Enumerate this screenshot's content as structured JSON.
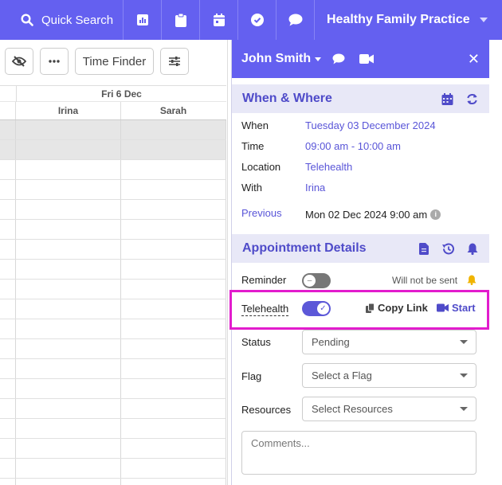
{
  "topnav": {
    "quick_search_label": "Quick Search",
    "practice_name": "Healthy Family Practice",
    "buttons": [
      "chart-icon",
      "clipboard-icon",
      "calendar-icon",
      "check-circle-icon",
      "chat-icon"
    ]
  },
  "toolbar": {
    "time_finder_label": "Time Finder"
  },
  "calendar": {
    "day_header": "Fri 6 Dec",
    "columns": [
      "Irina",
      "Sarah"
    ]
  },
  "panel": {
    "patient_name": "John Smith",
    "when_where": {
      "title": "When & Where",
      "when_label": "When",
      "when_value": "Tuesday 03 December 2024",
      "time_label": "Time",
      "time_value": "09:00 am - 10:00 am",
      "location_label": "Location",
      "location_value": "Telehealth",
      "with_label": "With",
      "with_value": "Irina",
      "previous_label": "Previous",
      "previous_value": "Mon 02 Dec 2024 9:00 am"
    },
    "details": {
      "title": "Appointment Details",
      "reminder_label": "Reminder",
      "reminder_status": "Will not be sent",
      "telehealth_label": "Telehealth",
      "copy_link_label": "Copy Link",
      "start_label": "Start",
      "status_label": "Status",
      "status_value": "Pending",
      "flag_label": "Flag",
      "flag_value": "Select a Flag",
      "resources_label": "Resources",
      "resources_value": "Select Resources",
      "comments_placeholder": "Comments..."
    }
  },
  "colors": {
    "brand": "#6460f0",
    "link": "#5955d8",
    "highlight": "#e21ccd",
    "bell": "#f0b400"
  }
}
